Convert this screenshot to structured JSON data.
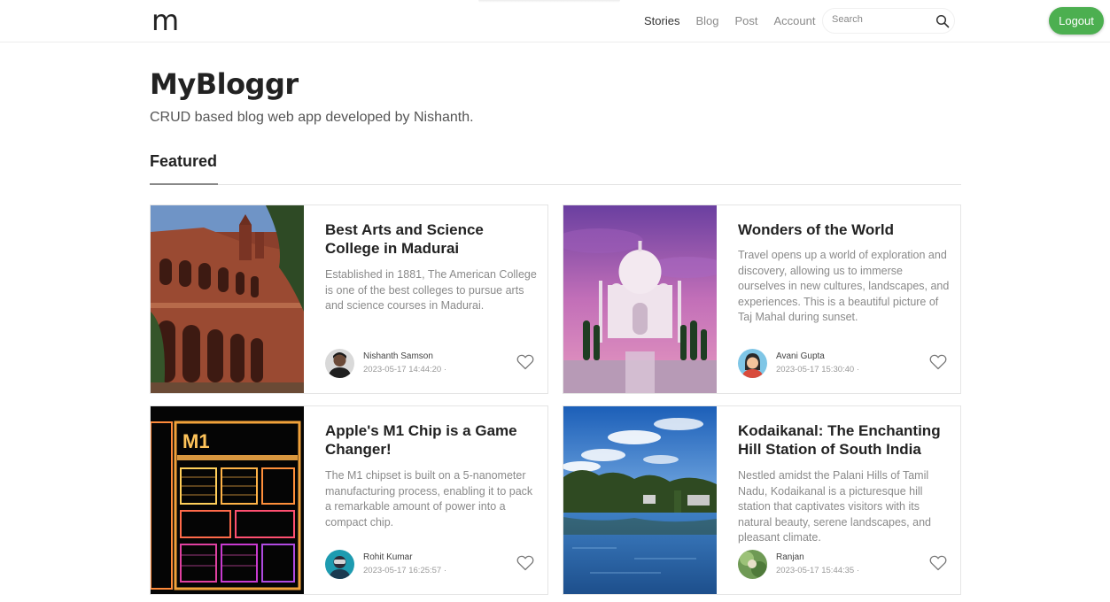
{
  "nav": {
    "logo": "m",
    "links": [
      "Stories",
      "Blog",
      "Post",
      "Account"
    ],
    "search_placeholder": "Search",
    "logout_label": "Logout"
  },
  "header": {
    "title": "MyBloggr",
    "subtitle": "CRUD based blog web app developed by Nishanth.",
    "section_title": "Featured"
  },
  "posts": [
    {
      "title": "Best Arts and Science College in Madurai",
      "excerpt": "Established in 1881, The American College is one of the best colleges to pursue arts and science courses in Madurai.",
      "author": "Nishanth Samson",
      "date": "2023-05-17 14:44:20 ·"
    },
    {
      "title": "Wonders of the World",
      "excerpt": "Travel opens up a world of exploration and discovery, allowing us to immerse ourselves in new cultures, landscapes, and experiences. This is a beautiful picture of Taj Mahal during sunset.",
      "author": "Avani Gupta",
      "date": "2023-05-17 15:30:40 ·"
    },
    {
      "title": "Apple's M1 Chip is a Game Changer!",
      "excerpt": "The M1 chipset is built on a 5-nanometer manufacturing process, enabling it to pack a remarkable amount of power into a compact chip.",
      "author": "Rohit Kumar",
      "date": "2023-05-17 16:25:57 ·"
    },
    {
      "title": "Kodaikanal: The Enchanting Hill Station of South India",
      "excerpt": "Nestled amidst the Palani Hills of Tamil Nadu, Kodaikanal is a picturesque hill station that captivates visitors with its natural beauty, serene landscapes, and pleasant climate.",
      "author": "Ranjan",
      "date": "2023-05-17 15:44:35 ·"
    }
  ],
  "chip_image_label": "M1",
  "colors": {
    "accent": "#4caf50",
    "text_muted": "#8a8a8a"
  },
  "icons": [
    "search-icon",
    "heart-icon"
  ]
}
